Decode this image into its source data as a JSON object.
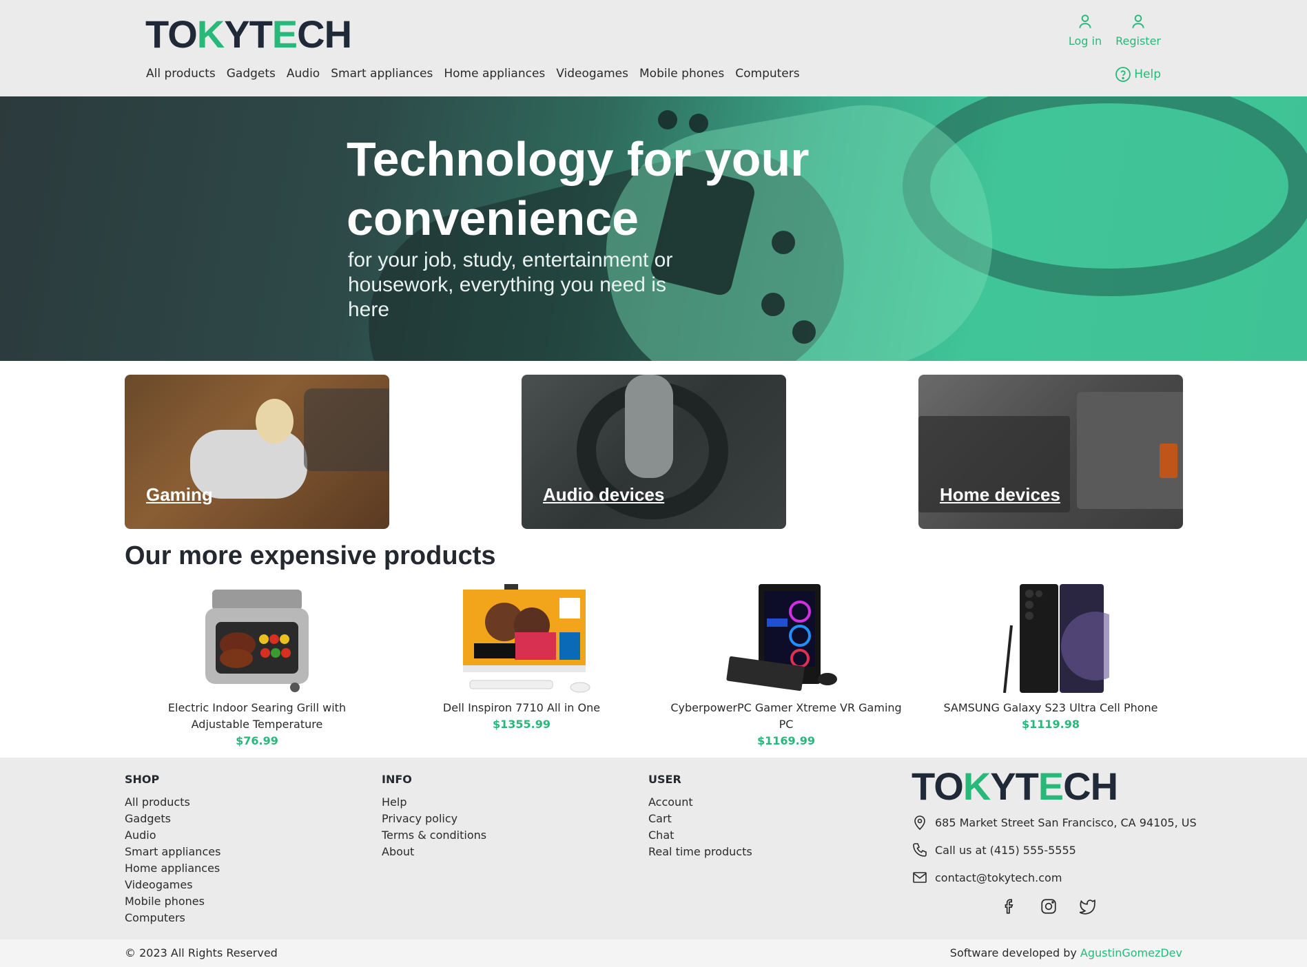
{
  "header": {
    "logo_text": "TOKYTECH",
    "nav": [
      "All products",
      "Gadgets",
      "Audio",
      "Smart appliances",
      "Home appliances",
      "Videogames",
      "Mobile phones",
      "Computers"
    ],
    "login_label": "Log in",
    "register_label": "Register",
    "help_label": "Help"
  },
  "hero": {
    "title": "Technology for your convenience",
    "subtitle": "for your job, study, entertainment or housework, everything you need is here"
  },
  "categories": [
    {
      "label": "Gaming"
    },
    {
      "label": "Audio devices"
    },
    {
      "label": "Home devices"
    }
  ],
  "products_section": {
    "title": "Our more expensive products",
    "items": [
      {
        "name": "Electric Indoor Searing Grill with Adjustable Temperature",
        "price": "$76.99"
      },
      {
        "name": "Dell Inspiron 7710 All in One",
        "price": "$1355.99"
      },
      {
        "name": "CyberpowerPC Gamer Xtreme VR Gaming PC",
        "price": "$1169.99"
      },
      {
        "name": "SAMSUNG Galaxy S23 Ultra Cell Phone",
        "price": "$1119.98"
      }
    ]
  },
  "footer": {
    "shop": {
      "heading": "SHOP",
      "links": [
        "All products",
        "Gadgets",
        "Audio",
        "Smart appliances",
        "Home appliances",
        "Videogames",
        "Mobile phones",
        "Computers"
      ]
    },
    "info": {
      "heading": "INFO",
      "links": [
        "Help",
        "Privacy policy",
        "Terms & conditions",
        "About"
      ]
    },
    "user": {
      "heading": "USER",
      "links": [
        "Account",
        "Cart",
        "Chat",
        "Real time products"
      ]
    },
    "logo_text": "TOKYTECH",
    "address": "685 Market Street San Francisco, CA 94105, US",
    "phone": "Call us at (415) 555-5555",
    "email": "contact@tokytech.com",
    "copyright": "© 2023 All Rights Reserved",
    "developed_by": "Software developed by",
    "developer": "AgustinGomezDev"
  },
  "colors": {
    "accent": "#27b87a",
    "header_bg": "#ebebeb",
    "text_dark": "#24292f"
  },
  "icons": [
    "user-icon",
    "help-circle-icon",
    "map-pin-icon",
    "phone-icon",
    "mail-icon",
    "facebook-icon",
    "instagram-icon",
    "twitter-icon"
  ]
}
